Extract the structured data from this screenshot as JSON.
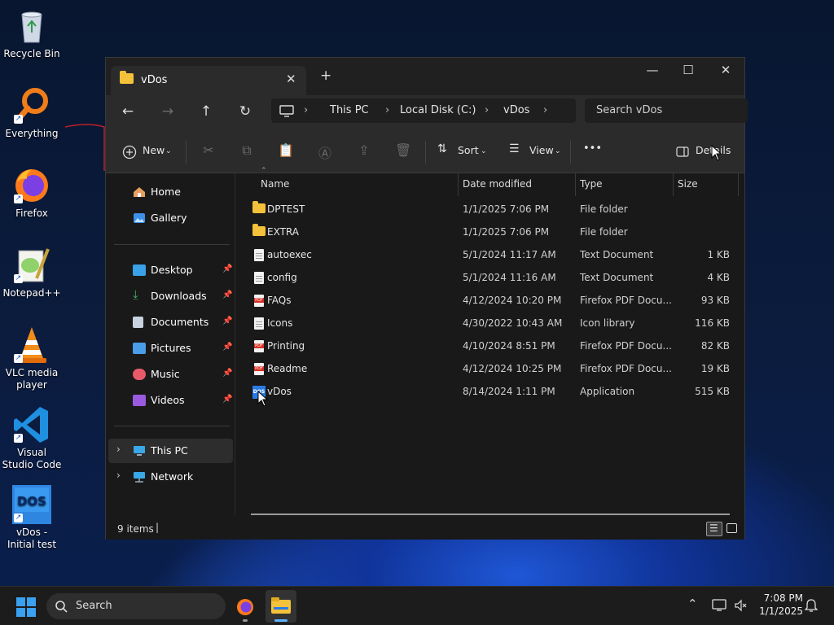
{
  "desktop": {
    "icons": [
      {
        "label": "Recycle Bin",
        "icon": "recycle-bin-icon"
      },
      {
        "label": "Everything",
        "icon": "everything-search-icon"
      },
      {
        "label": "Firefox",
        "icon": "firefox-icon"
      },
      {
        "label": "Notepad++",
        "icon": "notepadpp-icon"
      },
      {
        "label": "VLC media player",
        "icon": "vlc-icon"
      },
      {
        "label": "Visual Studio Code",
        "icon": "vscode-icon"
      },
      {
        "label": "vDos - Initial test",
        "icon": "vdos-icon"
      }
    ]
  },
  "window": {
    "tab_title": "vDos",
    "new_tab": "+",
    "breadcrumb": [
      "This PC",
      "Local Disk (C:)",
      "vDos"
    ],
    "search_placeholder": "Search vDos",
    "toolbar": {
      "new_label": "New",
      "sort_label": "Sort",
      "view_label": "View",
      "more_label": "•••",
      "details_label": "Details"
    },
    "sidebar": {
      "quick": [
        {
          "label": "Home",
          "icon": "home-icon"
        },
        {
          "label": "Gallery",
          "icon": "gallery-icon"
        }
      ],
      "pinned": [
        {
          "label": "Desktop",
          "icon": "desktop-folder-icon"
        },
        {
          "label": "Downloads",
          "icon": "downloads-folder-icon"
        },
        {
          "label": "Documents",
          "icon": "documents-folder-icon"
        },
        {
          "label": "Pictures",
          "icon": "pictures-folder-icon"
        },
        {
          "label": "Music",
          "icon": "music-folder-icon"
        },
        {
          "label": "Videos",
          "icon": "videos-folder-icon"
        }
      ],
      "drives": [
        {
          "label": "This PC",
          "icon": "this-pc-icon",
          "selected": true
        },
        {
          "label": "Network",
          "icon": "network-icon",
          "selected": false
        }
      ]
    },
    "columns": [
      "Name",
      "Date modified",
      "Type",
      "Size"
    ],
    "files": [
      {
        "name": "DPTEST",
        "date": "1/1/2025 7:06 PM",
        "type": "File folder",
        "size": "",
        "icon": "folder-icon"
      },
      {
        "name": "EXTRA",
        "date": "1/1/2025 7:06 PM",
        "type": "File folder",
        "size": "",
        "icon": "folder-icon"
      },
      {
        "name": "autoexec",
        "date": "5/1/2024 11:17 AM",
        "type": "Text Document",
        "size": "1 KB",
        "icon": "text-file-icon"
      },
      {
        "name": "config",
        "date": "5/1/2024 11:16 AM",
        "type": "Text Document",
        "size": "4 KB",
        "icon": "text-file-icon"
      },
      {
        "name": "FAQs",
        "date": "4/12/2024 10:20 PM",
        "type": "Firefox PDF Docu...",
        "size": "93 KB",
        "icon": "pdf-file-icon"
      },
      {
        "name": "Icons",
        "date": "4/30/2022 10:43 AM",
        "type": "Icon library",
        "size": "116 KB",
        "icon": "icon-library-icon"
      },
      {
        "name": "Printing",
        "date": "4/10/2024 8:51 PM",
        "type": "Firefox PDF Docu...",
        "size": "82 KB",
        "icon": "pdf-file-icon"
      },
      {
        "name": "Readme",
        "date": "4/12/2024 10:25 PM",
        "type": "Firefox PDF Docu...",
        "size": "19 KB",
        "icon": "pdf-file-icon"
      },
      {
        "name": "vDos",
        "date": "8/14/2024 1:11 PM",
        "type": "Application",
        "size": "515 KB",
        "icon": "application-icon"
      }
    ],
    "status": "9 items"
  },
  "taskbar": {
    "search_label": "Search",
    "time": "7:08 PM",
    "date": "1/1/2025"
  }
}
